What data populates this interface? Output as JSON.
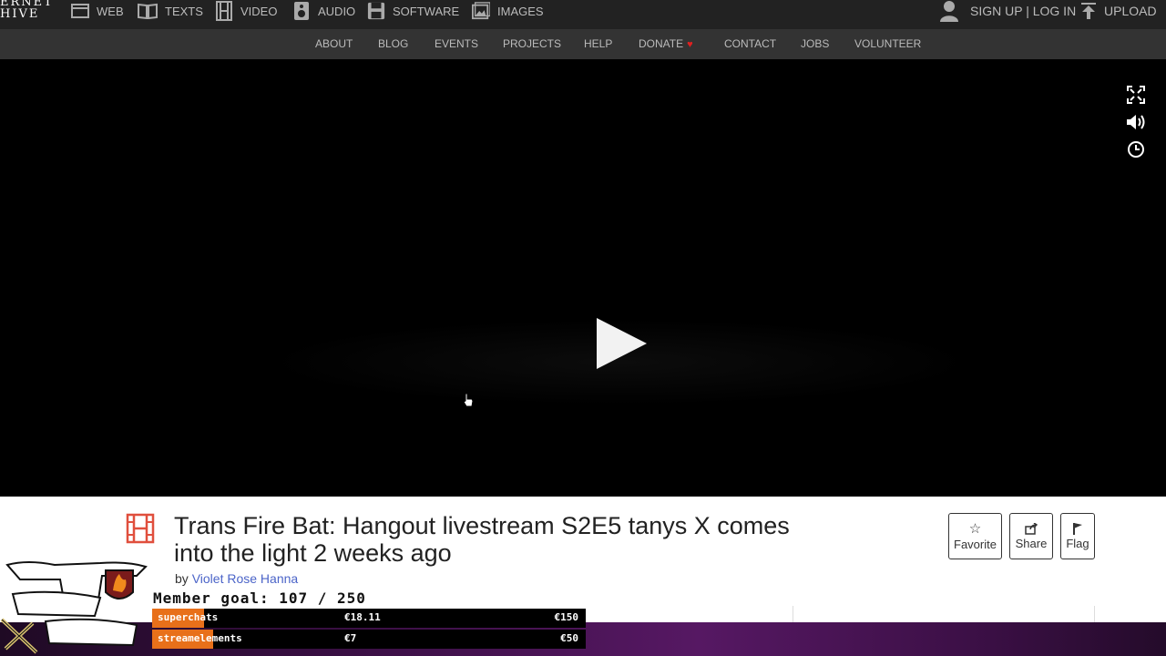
{
  "logo": {
    "line1": "ERNET",
    "line2": "HIVE"
  },
  "topnav": [
    {
      "label": "WEB",
      "icon": "web-icon"
    },
    {
      "label": "TEXTS",
      "icon": "book-icon"
    },
    {
      "label": "VIDEO",
      "icon": "film-icon"
    },
    {
      "label": "AUDIO",
      "icon": "speaker-icon"
    },
    {
      "label": "SOFTWARE",
      "icon": "floppy-icon"
    },
    {
      "label": "IMAGES",
      "icon": "image-icon"
    }
  ],
  "account": {
    "signup": "SIGN UP | LOG IN",
    "upload": "UPLOAD"
  },
  "subnav": [
    "ABOUT",
    "BLOG",
    "EVENTS",
    "PROJECTS",
    "HELP",
    "DONATE",
    "CONTACT",
    "JOBS",
    "VOLUNTEER"
  ],
  "item": {
    "title": "Trans Fire Bat: Hangout livestream S2E5 tanys X comes into the light 2 weeks ago",
    "by_prefix": "by",
    "author": "Violet Rose Hanna"
  },
  "actions": {
    "favorite": "Favorite",
    "share": "Share",
    "flag": "Flag"
  },
  "overlay": {
    "goal": "Member goal: 107 / 250",
    "bars": [
      {
        "label": "superchats",
        "current": "€18.11",
        "max": "€150",
        "progress": 0.12
      },
      {
        "label": "streamelements",
        "current": "€7",
        "max": "€50",
        "progress": 0.14
      }
    ]
  },
  "colors": {
    "accent": "#e02020",
    "link": "#4b64c8",
    "progress": "#e8701a",
    "film_icon": "#e04f3d"
  }
}
